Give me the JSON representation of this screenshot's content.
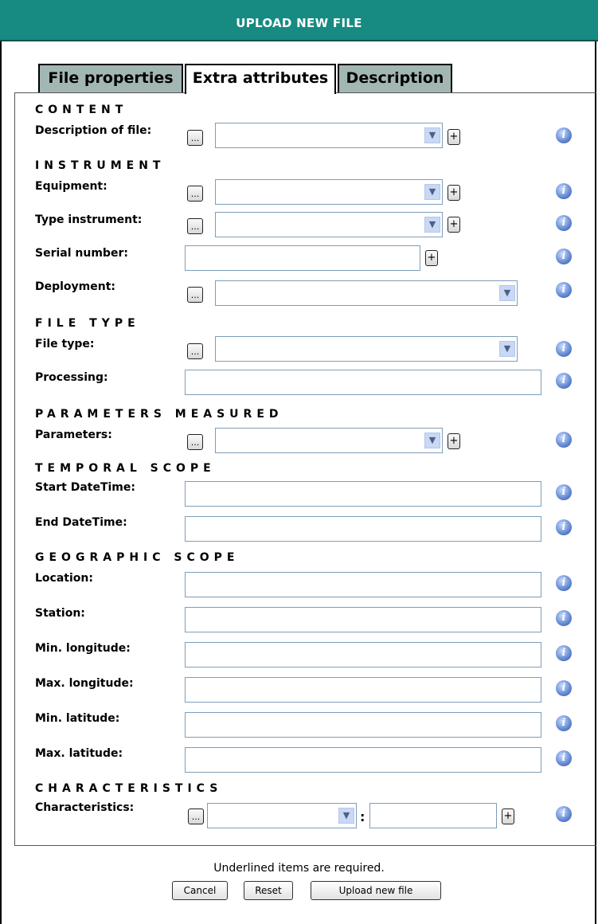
{
  "title": "UPLOAD NEW FILE",
  "tabs": {
    "file_properties": "File properties",
    "extra_attributes": "Extra attributes",
    "description": "Description"
  },
  "sections": {
    "content": "Content",
    "instrument": "Instrument",
    "file_type": "File type",
    "parameters_measured": "Parameters measured",
    "temporal_scope": "Temporal scope",
    "geographic_scope": "Geographic scope",
    "characteristics": "Characteristics"
  },
  "fields": {
    "description_of_file": "Description of file:",
    "equipment": "Equipment:",
    "type_instrument": "Type instrument:",
    "serial_number": "Serial number:",
    "deployment": "Deployment:",
    "file_type": "File type:",
    "processing": "Processing:",
    "parameters": "Parameters:",
    "start_datetime": "Start DateTime:",
    "end_datetime": "End DateTime:",
    "location": "Location:",
    "station": "Station:",
    "min_longitude": "Min. longitude:",
    "max_longitude": "Max. longitude:",
    "min_latitude": "Min. latitude:",
    "max_latitude": "Max. latitude:",
    "characteristics": "Characteristics:"
  },
  "glyphs": {
    "dots": "...",
    "plus": "+",
    "arrow": "▼",
    "info": "i",
    "colon": ":"
  },
  "footer": {
    "note": "Underlined items are required.",
    "cancel": "Cancel",
    "reset": "Reset",
    "upload": "Upload new file"
  },
  "colors": {
    "titlebar": "#178a82",
    "tab_inactive": "#a2b7b4",
    "info_icon": "#3a64b8"
  }
}
